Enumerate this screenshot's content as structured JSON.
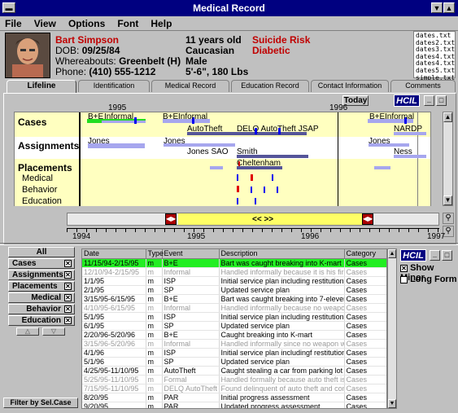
{
  "window": {
    "title": "Medical Record"
  },
  "menu": [
    "File",
    "View",
    "Options",
    "Font",
    "Help"
  ],
  "patient": {
    "name": "Bart Simpson",
    "dob_label": "DOB:",
    "dob": "09/25/84",
    "whereabouts_label": "Whereabouts:",
    "whereabouts": "Greenbelt (H)",
    "phone_label": "Phone:",
    "phone": "(410) 555-1212",
    "age": "11 years old",
    "ethnicity": "Caucasian",
    "sex": "Male",
    "height_weight": "5'-6\", 180 Lbs",
    "risk": "Suicide Risk",
    "condition": "Diabetic"
  },
  "files": [
    "dates.txt",
    "dates2.txt",
    "dates3.txt",
    "dates4.txt",
    "dates4.txt",
    "dates5.txt",
    "simple.txt"
  ],
  "tabs": [
    "Lifeline",
    "Identification",
    "Medical Record",
    "Education Record",
    "Contact Information",
    "Comments"
  ],
  "timeline": {
    "today_label": "Today",
    "logo": "HCIL",
    "year_1995": "1995",
    "year_1996": "1996",
    "lanes": {
      "cases": "Cases",
      "assignments": "Assignments",
      "placements": "Placements",
      "medical": "Medical",
      "behavior": "Behavior",
      "education": "Education"
    },
    "labels": {
      "be1": "B+E",
      "inf1": "Informal",
      "be2": "B+E",
      "inf2": "Informal",
      "be3": "B+E",
      "inf3": "Informal",
      "autotheft": "AutoTheft",
      "delq": "DELQ AutoTheft JSAP",
      "nardp": "NARDP",
      "jones1": "Jones",
      "jones2": "Jones",
      "jones3": "Jones",
      "jones_sao": "Jones SAO",
      "smith": "Smith",
      "ness": "Ness",
      "cheltenham": "Cheltenham"
    },
    "scroll_label": "<< >>",
    "axis_years": [
      "1994",
      "1995",
      "1996",
      "1997"
    ]
  },
  "filters": {
    "all": "All",
    "items": [
      "Cases",
      "Assignments",
      "Placements",
      "Medical",
      "Behavior",
      "Education"
    ],
    "filter_button": "Filter by Sel.Case"
  },
  "table": {
    "columns": [
      "Date",
      "Type",
      "Event",
      "Description",
      "Category"
    ],
    "rows": [
      {
        "date": "11/15/94-2/15/95",
        "type": "m",
        "event": "B+E",
        "desc": "Bart was caught breaking into K-mart",
        "cat": "Cases",
        "style": "sel"
      },
      {
        "date": "12/10/94-2/15/95",
        "type": "m",
        "event": "Informal",
        "desc": "Handled informally because it is his first offe",
        "cat": "Cases",
        "style": "gray"
      },
      {
        "date": "1/1/95",
        "type": "m",
        "event": "ISP",
        "desc": "Initial service plan including restitution",
        "cat": "Cases",
        "style": ""
      },
      {
        "date": "2/1/95",
        "type": "m",
        "event": "SP",
        "desc": "Updated service plan",
        "cat": "Cases",
        "style": ""
      },
      {
        "date": "3/15/95-6/15/95",
        "type": "m",
        "event": "B+E",
        "desc": "Bart was caught breaking into 7-eleven",
        "cat": "Cases",
        "style": ""
      },
      {
        "date": "4/10/95-6/15/95",
        "type": "m",
        "event": "Informal",
        "desc": "Handled informally because no weapon wa",
        "cat": "Cases",
        "style": "gray"
      },
      {
        "date": "5/1/95",
        "type": "m",
        "event": "ISP",
        "desc": "Initial service plan including restitution",
        "cat": "Cases",
        "style": ""
      },
      {
        "date": "6/1/95",
        "type": "m",
        "event": "SP",
        "desc": "Updated service plan",
        "cat": "Cases",
        "style": ""
      },
      {
        "date": "2/20/96-5/20/96",
        "type": "m",
        "event": "B+E",
        "desc": "Caught breaking into K-mart",
        "cat": "Cases",
        "style": ""
      },
      {
        "date": "3/15/96-5/20/96",
        "type": "m",
        "event": "Informal",
        "desc": "Handled informally since no weapon was ir",
        "cat": "Cases",
        "style": "gray"
      },
      {
        "date": "4/1/96",
        "type": "m",
        "event": "ISP",
        "desc": "Initial service plan includingf restitution",
        "cat": "Cases",
        "style": ""
      },
      {
        "date": "5/1/96",
        "type": "m",
        "event": "SP",
        "desc": "Updated service plan",
        "cat": "Cases",
        "style": ""
      },
      {
        "date": "4/25/95-11/10/95",
        "type": "m",
        "event": "AutoTheft",
        "desc": "Caught stealing a car from parking lot",
        "cat": "Cases",
        "style": ""
      },
      {
        "date": "5/25/95-11/10/95",
        "type": "m",
        "event": "Formal",
        "desc": "Handled formally because auto theft is a fe",
        "cat": "Cases",
        "style": "gray"
      },
      {
        "date": "7/15/95-11/10/95",
        "type": "m",
        "event": "DELQ AutoTheft JS",
        "desc": "Found delinquent of auto theft and commit",
        "cat": "Cases",
        "style": "gray"
      },
      {
        "date": "8/20/95",
        "type": "m",
        "event": "PAR",
        "desc": "Initial progress assessment",
        "cat": "Cases",
        "style": ""
      },
      {
        "date": "9/20/95",
        "type": "m",
        "event": "PAR",
        "desc": "Updated progress assessment",
        "cat": "Cases",
        "style": ""
      }
    ]
  },
  "options": {
    "logo": "HCIL",
    "show_minor": "Show Minor",
    "show_minor_checked": true,
    "long_form": "Long Form",
    "long_form_checked": false
  }
}
